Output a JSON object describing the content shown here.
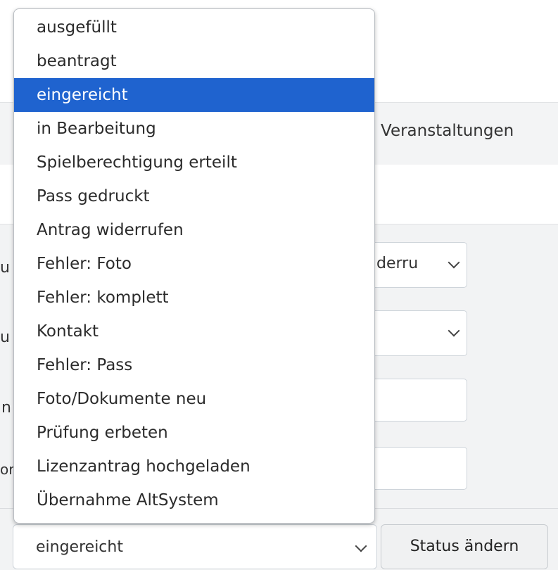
{
  "nav": {
    "item": "Veranstaltungen"
  },
  "form": {
    "row1_label_fragment": "u",
    "row1_value_fragment": "derru",
    "row2_label_fragment": "u",
    "row3_label_fragment": "n",
    "row4_label_fragment": "or"
  },
  "status_select": {
    "value": "eingereicht"
  },
  "status_button": {
    "label": "Status ändern"
  },
  "dropdown": {
    "selected_index": 2,
    "options": [
      "ausgefüllt",
      "beantragt",
      "eingereicht",
      "in Bearbeitung",
      "Spielberechtigung erteilt",
      "Pass gedruckt",
      "Antrag widerrufen",
      "Fehler: Foto",
      "Fehler: komplett",
      "Kontakt",
      "Fehler: Pass",
      "Foto/Dokumente neu",
      "Prüfung erbeten",
      "Lizenzantrag hochgeladen",
      "Übernahme AltSystem"
    ]
  },
  "colors": {
    "selected_bg": "#1f63cf",
    "panel_bg": "#f2f3f4",
    "nav_bg": "#f3f4f5"
  }
}
